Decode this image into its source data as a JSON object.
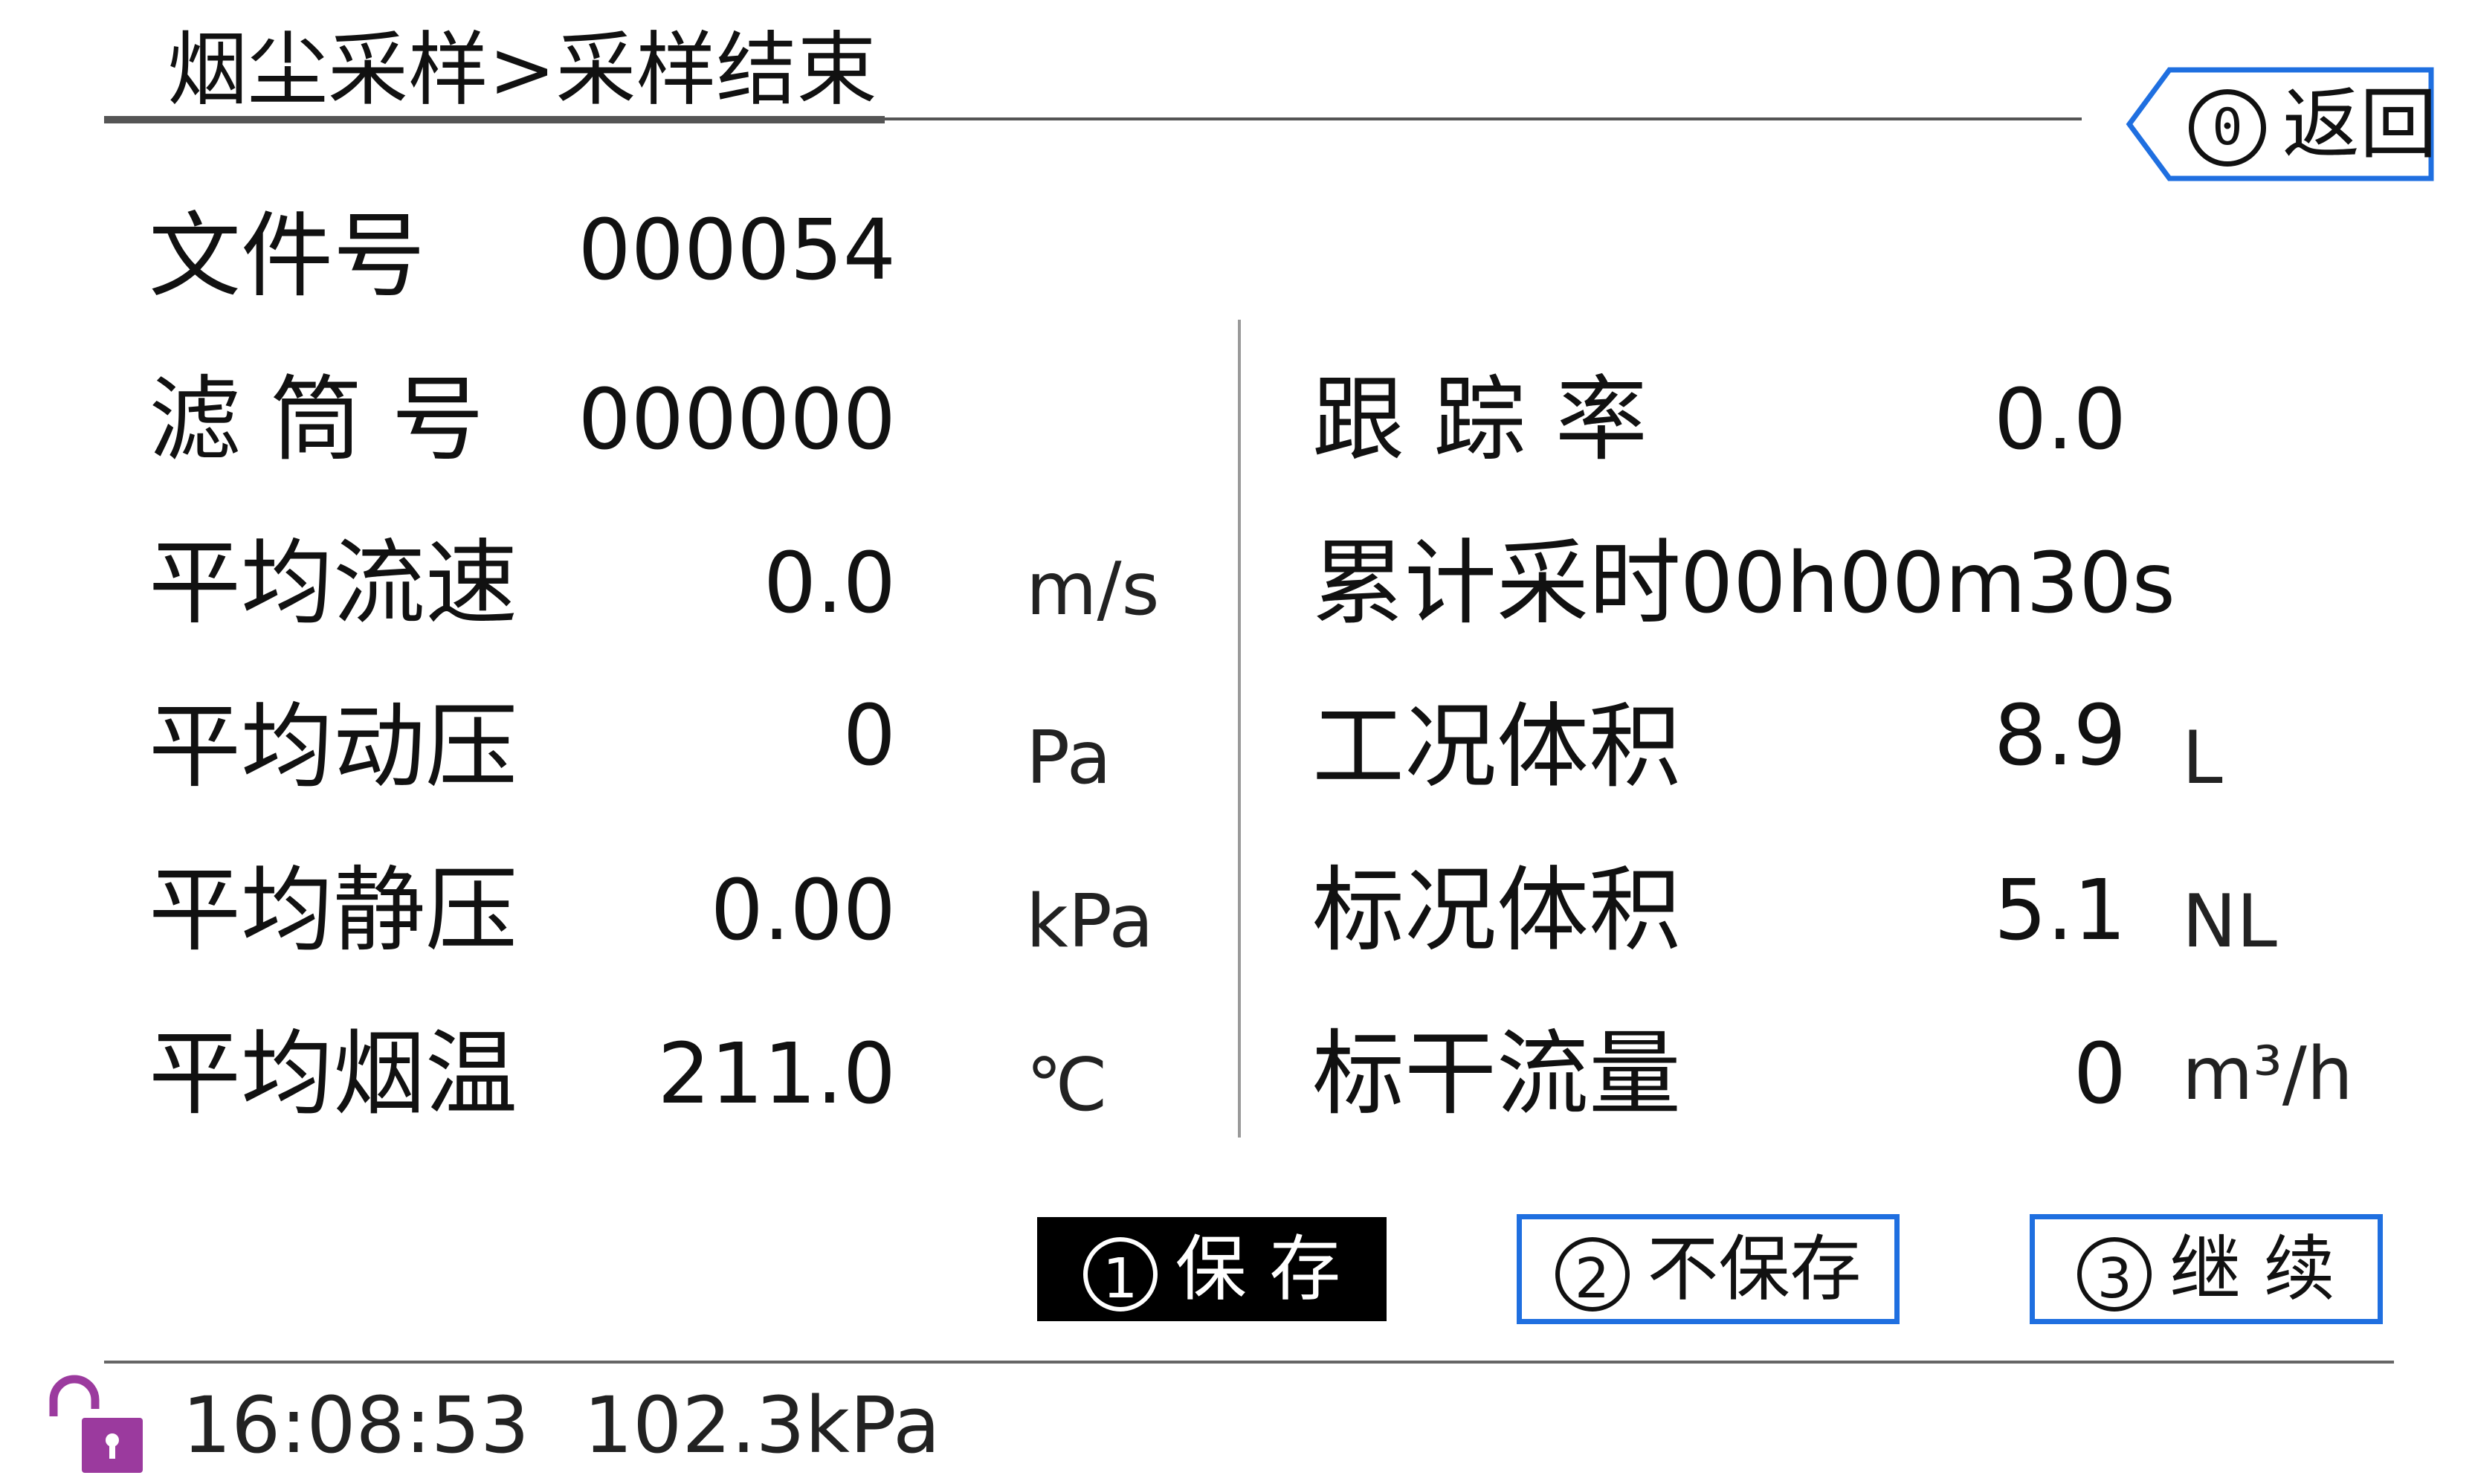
{
  "header": {
    "title": "烟尘采样>采样结束",
    "back_number": "0",
    "back_label": "返回"
  },
  "left_fields": [
    {
      "label": "文件号",
      "value": "000054",
      "unit": ""
    },
    {
      "label": "滤 筒 号",
      "value": "000000",
      "unit": ""
    },
    {
      "label": "平均流速",
      "value": "0.0",
      "unit": "m/s"
    },
    {
      "label": "平均动压",
      "value": "0",
      "unit": "Pa"
    },
    {
      "label": "平均静压",
      "value": "0.00",
      "unit": "kPa"
    },
    {
      "label": "平均烟温",
      "value": "211.0",
      "unit": "℃"
    }
  ],
  "right_fields": [
    {
      "label": "跟 踪 率",
      "value": "0.0",
      "unit": ""
    },
    {
      "label": "累计采时",
      "value": "00h00m30s",
      "unit": ""
    },
    {
      "label": "工况体积",
      "value": "8.9",
      "unit": "L"
    },
    {
      "label": "标况体积",
      "value": "5.1",
      "unit": "NL"
    },
    {
      "label": "标干流量",
      "value": "0",
      "unit": "m³/h"
    }
  ],
  "buttons": {
    "save": {
      "number": "1",
      "label": "保 存"
    },
    "no_save": {
      "number": "2",
      "label": "不保存"
    },
    "continue": {
      "number": "3",
      "label": "继 续"
    }
  },
  "status": {
    "time": "16:08:53",
    "pressure": "102.3kPa",
    "lock_icon": "unlocked-padlock-icon"
  },
  "colors": {
    "accent_blue": "#1f6fe0",
    "lock_purple": "#9b3a9e"
  }
}
